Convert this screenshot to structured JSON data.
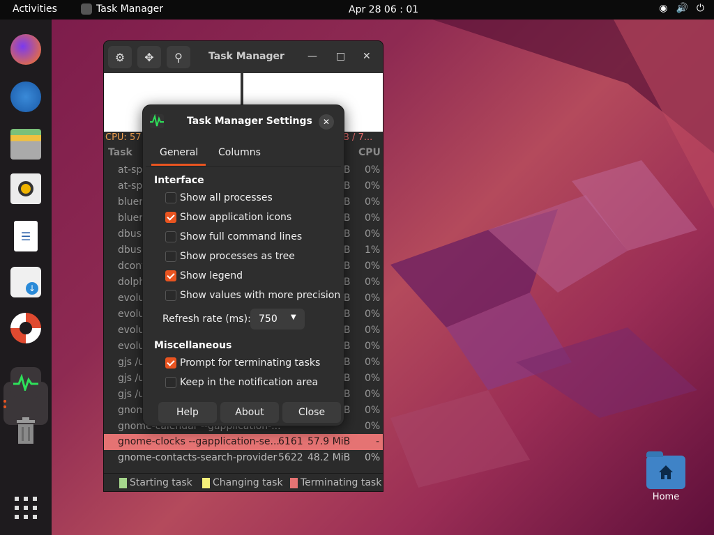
{
  "topbar": {
    "activities": "Activities",
    "app_name": "Task Manager",
    "clock": "Apr 28  06 : 01",
    "tray": [
      "network-icon",
      "volume-icon",
      "power-icon"
    ]
  },
  "dock": {
    "apps": [
      "Firefox",
      "Thunderbird",
      "Files",
      "Rhythmbox",
      "LibreOffice Writer",
      "Software",
      "Help",
      "Task Manager",
      "Trash"
    ],
    "show_apps": "apps-grid-icon"
  },
  "task_manager": {
    "title": "Task Manager",
    "cpu_text": "CPU: 57",
    "mem_text": "B / 7...",
    "col_task": "Task",
    "col_cpu": "CPU",
    "rows": [
      {
        "task": "at-spi",
        "mem": "iB",
        "cpu": "0%"
      },
      {
        "task": "at-spi",
        "mem": "iB",
        "cpu": "0%"
      },
      {
        "task": "bluen",
        "mem": "iB",
        "cpu": "0%"
      },
      {
        "task": "bluen",
        "mem": "iB",
        "cpu": "0%"
      },
      {
        "task": "dbus-",
        "mem": "iB",
        "cpu": "0%"
      },
      {
        "task": "dbus-",
        "mem": "iB",
        "cpu": "1%"
      },
      {
        "task": "dconf",
        "mem": "iB",
        "cpu": "0%"
      },
      {
        "task": "dolph",
        "mem": "iB",
        "cpu": "0%"
      },
      {
        "task": "evolu",
        "mem": "iB",
        "cpu": "0%"
      },
      {
        "task": "evolu",
        "mem": "iB",
        "cpu": "0%"
      },
      {
        "task": "evolu",
        "mem": "iB",
        "cpu": "0%"
      },
      {
        "task": "evolu",
        "mem": "iB",
        "cpu": "0%"
      },
      {
        "task": "gjs /u",
        "mem": "iB",
        "cpu": "0%"
      },
      {
        "task": "gjs /u",
        "mem": "iB",
        "cpu": "0%"
      },
      {
        "task": "gjs /u",
        "mem": "iB",
        "cpu": "0%"
      },
      {
        "task": "gnom",
        "mem": "iB",
        "cpu": "0%"
      },
      {
        "task": "gnome-calendar --gapplication-...",
        "mem": "",
        "cpu": "0%"
      }
    ],
    "highlight_row": {
      "task": "gnome-clocks --gapplication-se...",
      "pid": "6161",
      "mem": "57.9 MiB",
      "cpu": "-"
    },
    "last_row": {
      "task": "gnome-contacts-search-provider",
      "pid": "5622",
      "mem": "48.2 MiB",
      "cpu": "0%"
    },
    "legend": {
      "starting": "Starting task",
      "changing": "Changing task",
      "terminating": "Terminating task",
      "colors": {
        "starting": "#a5d68c",
        "changing": "#f5f07a",
        "terminating": "#e57373"
      }
    }
  },
  "settings_dialog": {
    "title": "Task Manager Settings",
    "tabs": {
      "general": "General",
      "columns": "Columns"
    },
    "interface_heading": "Interface",
    "options": [
      {
        "label": "Show all processes",
        "checked": false
      },
      {
        "label": "Show application icons",
        "checked": true
      },
      {
        "label": "Show full command lines",
        "checked": false
      },
      {
        "label": "Show processes as tree",
        "checked": false
      },
      {
        "label": "Show legend",
        "checked": true
      },
      {
        "label": "Show values with more precision",
        "checked": false
      }
    ],
    "refresh_label": "Refresh rate (ms):",
    "refresh_value": "750",
    "misc_heading": "Miscellaneous",
    "misc_options": [
      {
        "label": "Prompt for terminating tasks",
        "checked": true
      },
      {
        "label": "Keep in the notification area",
        "checked": false
      }
    ],
    "buttons": {
      "help": "Help",
      "about": "About",
      "close": "Close"
    }
  },
  "desktop": {
    "home_label": "Home"
  },
  "accent_color": "#e95420"
}
